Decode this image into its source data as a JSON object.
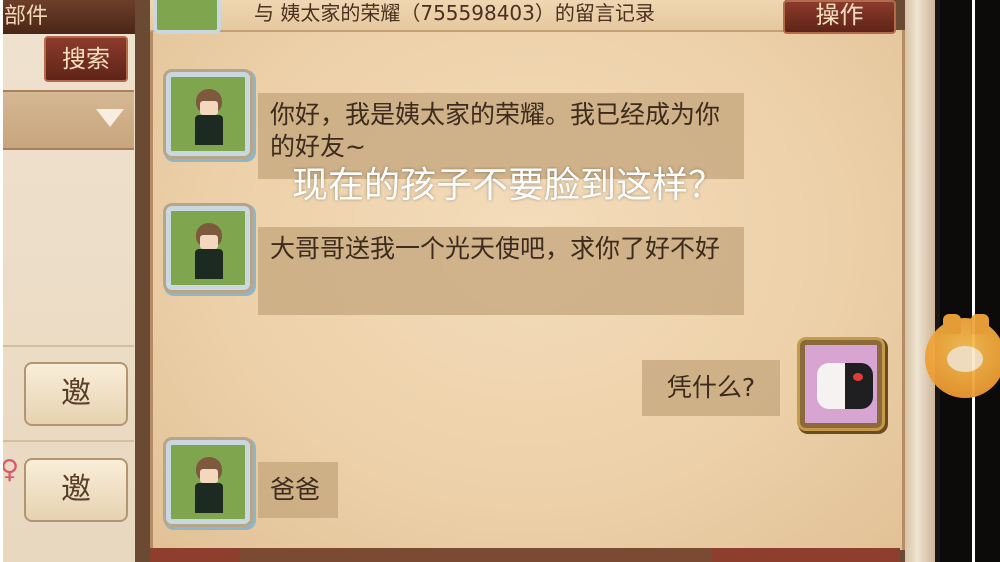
{
  "header": {
    "title": "与 姨太家的荣耀（755598403）的留言记录",
    "operate_label": "操作"
  },
  "sidebar": {
    "top_tab_label": "部件",
    "search_label": "搜索",
    "invite_buttons": [
      {
        "label": "邀"
      },
      {
        "label": "邀"
      }
    ],
    "gender_symbol": "♀"
  },
  "messages": [
    {
      "side": "left",
      "avatar": "boy-character-avatar",
      "text": "你好，我是姨太家的荣耀。我已经成为你的好友~"
    },
    {
      "side": "left",
      "avatar": "boy-character-avatar",
      "text": "大哥哥送我一个光天使吧，求你了好不好"
    },
    {
      "side": "right",
      "avatar": "monokuma-avatar",
      "text": "凭什么?"
    },
    {
      "side": "left",
      "avatar": "boy-character-avatar",
      "text": "爸爸"
    }
  ],
  "overlay": {
    "caption": "现在的孩子不要脸到这样？"
  }
}
